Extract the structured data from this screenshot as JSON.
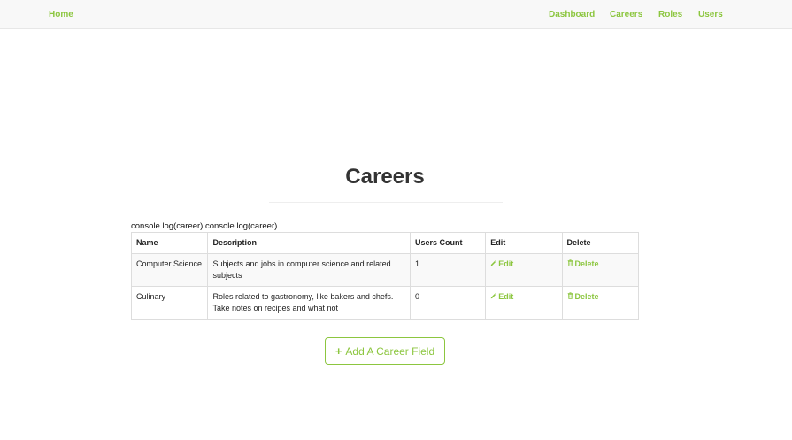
{
  "navbar": {
    "home": "Home",
    "links": [
      "Dashboard",
      "Careers",
      "Roles",
      "Users"
    ]
  },
  "page": {
    "title": "Careers",
    "console_text": "console.log(career) console.log(career)"
  },
  "table": {
    "headers": [
      "Name",
      "Description",
      "Users Count",
      "Edit",
      "Delete"
    ],
    "rows": [
      {
        "name": "Computer Science",
        "description": "Subjects and jobs in computer science and related subjects",
        "users_count": "1",
        "edit": "Edit",
        "delete": "Delete"
      },
      {
        "name": "Culinary",
        "description": "Roles related to gastronomy, like bakers and chefs. Take notes on recipes and what not",
        "users_count": "0",
        "edit": "Edit",
        "delete": "Delete"
      }
    ]
  },
  "add_button": {
    "label": "Add A Career Field",
    "icon": "plus-icon"
  },
  "colors": {
    "accent": "#8cc63f",
    "navbar_bg": "#f8f8f8",
    "border": "#dddddd"
  }
}
